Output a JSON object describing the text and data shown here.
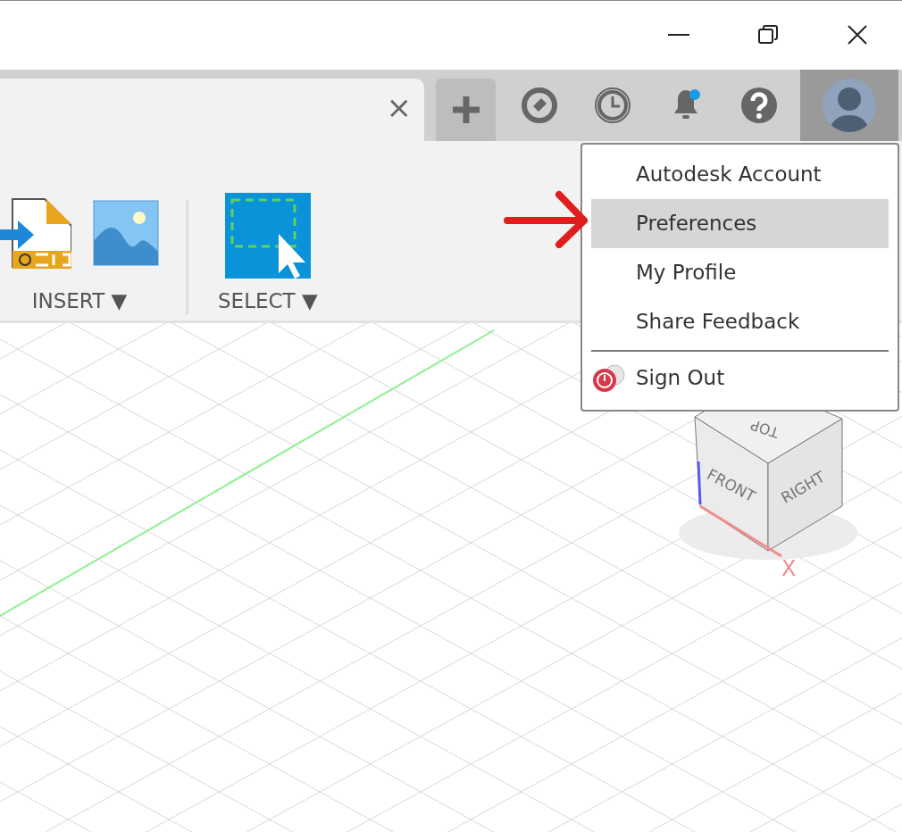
{
  "document_tab": {
    "close": "×"
  },
  "toolbar": {
    "groups": [
      {
        "label": "INSERT",
        "caret": "▼"
      },
      {
        "label": "SELECT",
        "caret": "▼"
      }
    ]
  },
  "notification": {
    "unread": true
  },
  "account_menu": {
    "open": true,
    "items": [
      {
        "label": "Autodesk Account",
        "kind": "item",
        "selected": false
      },
      {
        "label": "Preferences",
        "kind": "item",
        "selected": true
      },
      {
        "label": "My Profile",
        "kind": "item",
        "selected": false
      },
      {
        "label": "Share Feedback",
        "kind": "item",
        "selected": false
      },
      {
        "label": "Sign Out",
        "kind": "signout",
        "selected": false
      }
    ]
  },
  "view_cube": {
    "top": "TOP",
    "front": "FRONT",
    "right": "RIGHT",
    "x_axis": "X"
  }
}
